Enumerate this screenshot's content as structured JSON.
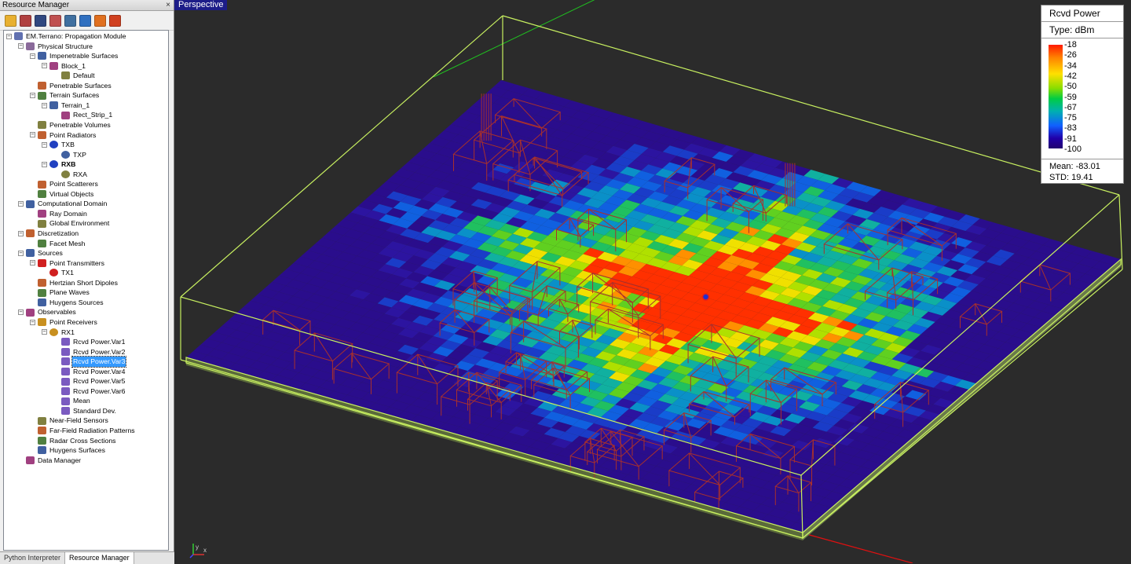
{
  "resource_manager": {
    "title": "Resource Manager",
    "close_glyph": "×",
    "toolbar_icons": [
      "python-script-icon",
      "structure-icon",
      "resource-panel-icon",
      "display-icon",
      "tree-icon",
      "plane-icon",
      "fire-icon",
      "target-icon"
    ],
    "tree": [
      {
        "label": "EM.Terrano: Propagation Module",
        "level": 0,
        "expander": "−",
        "icon": "em-terrano-icon"
      },
      {
        "label": "Physical Structure",
        "level": 1,
        "expander": "−",
        "icon": "structure-icon"
      },
      {
        "label": "Impenetrable Surfaces",
        "level": 2,
        "expander": "−",
        "icon": "impenetrable-surfaces-icon"
      },
      {
        "label": "Block_1",
        "level": 3,
        "expander": "−",
        "icon": "block-icon"
      },
      {
        "label": "Default",
        "level": 4,
        "expander": "",
        "icon": "default-material-icon"
      },
      {
        "label": "Penetrable Surfaces",
        "level": 2,
        "expander": "",
        "icon": "penetrable-surfaces-icon"
      },
      {
        "label": "Terrain Surfaces",
        "level": 2,
        "expander": "−",
        "icon": "terrain-surfaces-icon"
      },
      {
        "label": "Terrain_1",
        "level": 3,
        "expander": "−",
        "icon": "terrain-icon"
      },
      {
        "label": "Rect_Strip_1",
        "level": 4,
        "expander": "",
        "icon": "rect-strip-icon"
      },
      {
        "label": "Penetrable Volumes",
        "level": 2,
        "expander": "",
        "icon": "penetrable-volumes-icon"
      },
      {
        "label": "Point Radiators",
        "level": 2,
        "expander": "−",
        "icon": "point-radiators-icon"
      },
      {
        "label": "TXB",
        "level": 3,
        "expander": "−",
        "icon": "txb-icon"
      },
      {
        "label": "TXP",
        "level": 4,
        "expander": "",
        "icon": "txp-icon"
      },
      {
        "label": "RXB",
        "level": 3,
        "expander": "−",
        "icon": "rxb-icon",
        "bold": true
      },
      {
        "label": "RXA",
        "level": 4,
        "expander": "",
        "icon": "rxa-icon"
      },
      {
        "label": "Point Scatterers",
        "level": 2,
        "expander": "",
        "icon": "point-scatterers-icon"
      },
      {
        "label": "Virtual Objects",
        "level": 2,
        "expander": "",
        "icon": "virtual-objects-icon"
      },
      {
        "label": "Computational Domain",
        "level": 1,
        "expander": "−",
        "icon": "computational-domain-icon"
      },
      {
        "label": "Ray Domain",
        "level": 2,
        "expander": "",
        "icon": "ray-domain-icon"
      },
      {
        "label": "Global Environment",
        "level": 2,
        "expander": "",
        "icon": "global-environment-icon"
      },
      {
        "label": "Discretization",
        "level": 1,
        "expander": "−",
        "icon": "discretization-icon"
      },
      {
        "label": "Facet Mesh",
        "level": 2,
        "expander": "",
        "icon": "facet-mesh-icon"
      },
      {
        "label": "Sources",
        "level": 1,
        "expander": "−",
        "icon": "sources-icon"
      },
      {
        "label": "Point Transmitters",
        "level": 2,
        "expander": "−",
        "icon": "point-transmitters-icon"
      },
      {
        "label": "TX1",
        "level": 3,
        "expander": "",
        "icon": "tx1-icon"
      },
      {
        "label": "Hertzian Short Dipoles",
        "level": 2,
        "expander": "",
        "icon": "hertzian-dipole-icon"
      },
      {
        "label": "Plane Waves",
        "level": 2,
        "expander": "",
        "icon": "plane-waves-icon"
      },
      {
        "label": "Huygens Sources",
        "level": 2,
        "expander": "",
        "icon": "huygens-sources-icon"
      },
      {
        "label": "Observables",
        "level": 1,
        "expander": "−",
        "icon": "observables-icon"
      },
      {
        "label": "Point Receivers",
        "level": 2,
        "expander": "−",
        "icon": "point-receivers-icon"
      },
      {
        "label": "RX1",
        "level": 3,
        "expander": "−",
        "icon": "rx1-icon"
      },
      {
        "label": "Rcvd Power.Var1",
        "level": 4,
        "expander": "",
        "icon": "data-icon"
      },
      {
        "label": "Rcvd Power.Var2",
        "level": 4,
        "expander": "",
        "icon": "data-icon"
      },
      {
        "label": "Rcvd Power.Var3",
        "level": 4,
        "expander": "",
        "icon": "data-icon",
        "selected": true
      },
      {
        "label": "Rcvd Power.Var4",
        "level": 4,
        "expander": "",
        "icon": "data-icon"
      },
      {
        "label": "Rcvd Power.Var5",
        "level": 4,
        "expander": "",
        "icon": "data-icon"
      },
      {
        "label": "Rcvd Power.Var6",
        "level": 4,
        "expander": "",
        "icon": "data-icon"
      },
      {
        "label": "Mean",
        "level": 4,
        "expander": "",
        "icon": "data-icon"
      },
      {
        "label": "Standard Dev.",
        "level": 4,
        "expander": "",
        "icon": "data-icon"
      },
      {
        "label": "Near-Field Sensors",
        "level": 2,
        "expander": "",
        "icon": "near-field-sensors-icon"
      },
      {
        "label": "Far-Field Radiation Patterns",
        "level": 2,
        "expander": "",
        "icon": "far-field-icon"
      },
      {
        "label": "Radar Cross Sections",
        "level": 2,
        "expander": "",
        "icon": "radar-cross-sections-icon"
      },
      {
        "label": "Huygens Surfaces",
        "level": 2,
        "expander": "",
        "icon": "huygens-surfaces-icon"
      },
      {
        "label": "Data Manager",
        "level": 1,
        "expander": "",
        "icon": "data-manager-icon"
      }
    ],
    "tabs": [
      {
        "label": "Python Interpreter",
        "active": false
      },
      {
        "label": "Resource Manager",
        "active": true
      }
    ]
  },
  "viewport": {
    "view_label": "Perspective",
    "axis_labels": {
      "x": "x",
      "y": "y"
    }
  },
  "legend": {
    "quantity": "Rcvd Power",
    "type": "Type: dBm",
    "ticks": [
      "-18",
      "-26",
      "-34",
      "-42",
      "-50",
      "-59",
      "-67",
      "-75",
      "-83",
      "-91",
      "-100"
    ],
    "mean": "Mean: -83.01",
    "std": "STD: 19.41"
  },
  "colors": {
    "background": "#2b2b2b",
    "bounding_box": "#c8f060",
    "buildings": "#a0302a",
    "selection": "#3399ff"
  }
}
